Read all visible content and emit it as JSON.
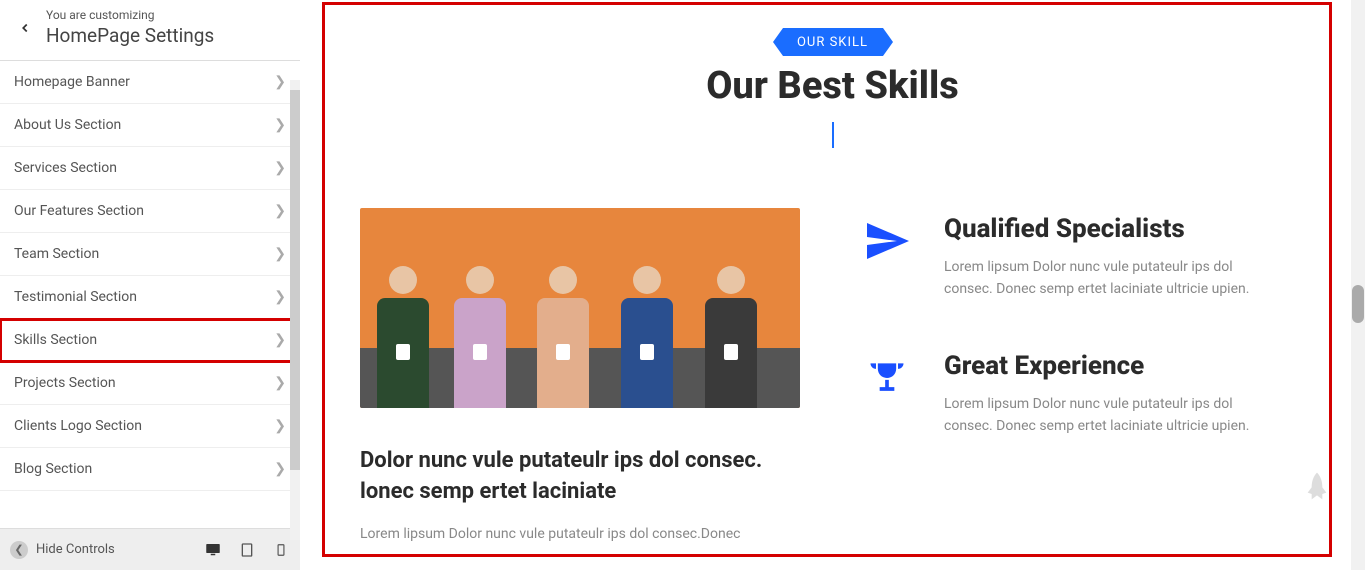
{
  "sidebar": {
    "pretitle": "You are customizing",
    "title": "HomePage Settings",
    "items": [
      {
        "label": "Homepage Banner"
      },
      {
        "label": "About Us Section"
      },
      {
        "label": "Services Section"
      },
      {
        "label": "Our Features Section"
      },
      {
        "label": "Team Section"
      },
      {
        "label": "Testimonial Section"
      },
      {
        "label": "Skills Section",
        "highlight": true
      },
      {
        "label": "Projects Section"
      },
      {
        "label": "Clients Logo Section"
      },
      {
        "label": "Blog Section"
      }
    ],
    "footer": {
      "hide": "Hide Controls"
    }
  },
  "preview": {
    "ribbon": "OUR SKILL",
    "title": "Our Best Skills",
    "left": {
      "title": "Dolor nunc vule putateulr ips dol consec. lonec semp ertet laciniate",
      "sub": "Lorem lipsum Dolor nunc vule putateulr ips dol consec.Donec"
    },
    "skills": [
      {
        "title": "Qualified Specialists",
        "desc": "Lorem lipsum Dolor nunc vule putateulr ips dol consec. Donec semp ertet laciniate ultricie upien."
      },
      {
        "title": "Great Experience",
        "desc": "Lorem lipsum Dolor nunc vule putateulr ips dol consec. Donec semp ertet laciniate ultricie upien."
      }
    ]
  }
}
